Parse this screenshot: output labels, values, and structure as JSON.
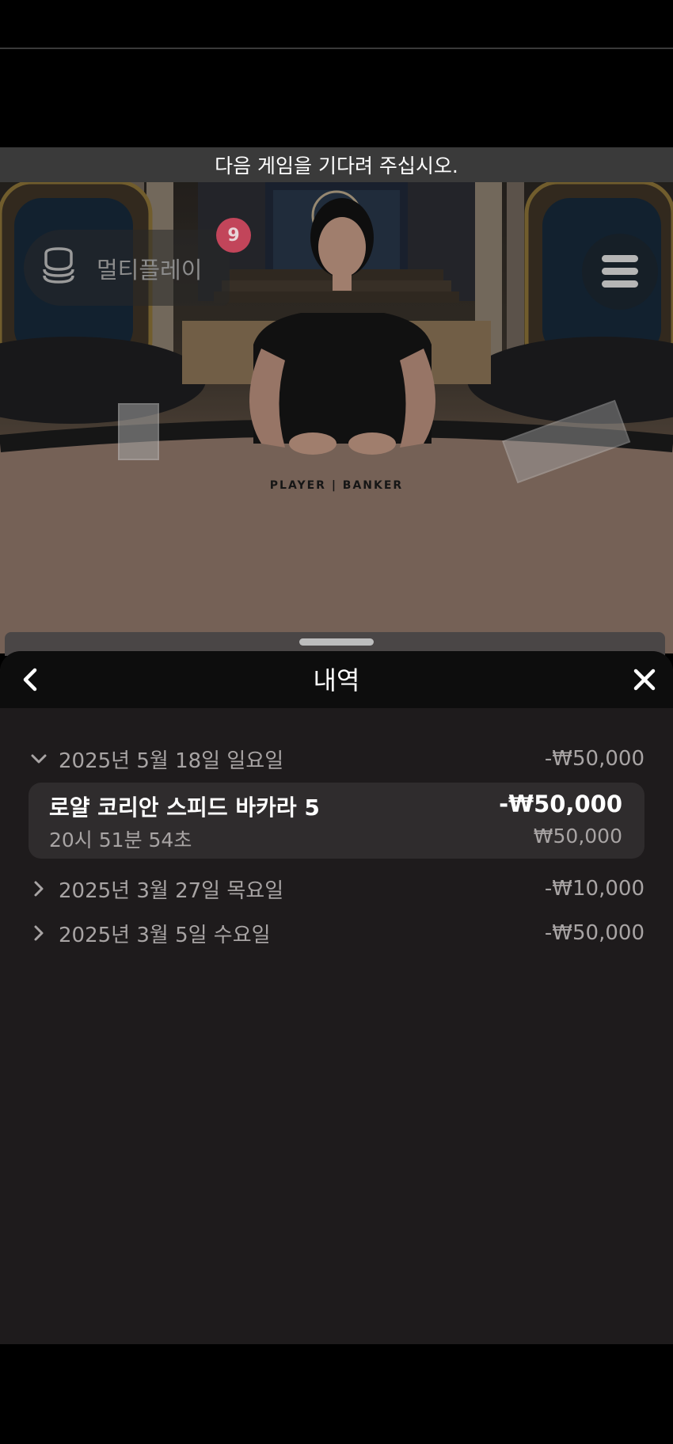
{
  "banner": {
    "text": "다음 게임을 기다려 주십시오."
  },
  "video": {
    "table_label": "PLAYER | BANKER"
  },
  "multiplay": {
    "label": "멀티플레이",
    "badge_count": "9"
  },
  "history": {
    "title": "내역",
    "groups": [
      {
        "date": "2025년 5월 18일 일요일",
        "amount": "-₩50,000",
        "expanded": true,
        "items": [
          {
            "game": "로얄 코리안 스피드 바카라 5",
            "time": "20시 51분 54초",
            "result": "-₩50,000",
            "bet": "₩50,000"
          }
        ]
      },
      {
        "date": "2025년 3월 27일 목요일",
        "amount": "-₩10,000",
        "expanded": false
      },
      {
        "date": "2025년 3월 5일 수요일",
        "amount": "-₩50,000",
        "expanded": false
      }
    ]
  },
  "icons": {
    "back": "chevron-left-icon",
    "close": "close-icon",
    "menu": "hamburger-menu-icon",
    "multiplay": "multiplay-icon",
    "expanded": "chevron-down-icon",
    "collapsed": "chevron-right-icon"
  },
  "colors": {
    "panel_bg": "#1e1b1c",
    "card_bg": "#2f2c2d",
    "badge": "#c2455a",
    "muted_text": "#a8a4a4"
  }
}
